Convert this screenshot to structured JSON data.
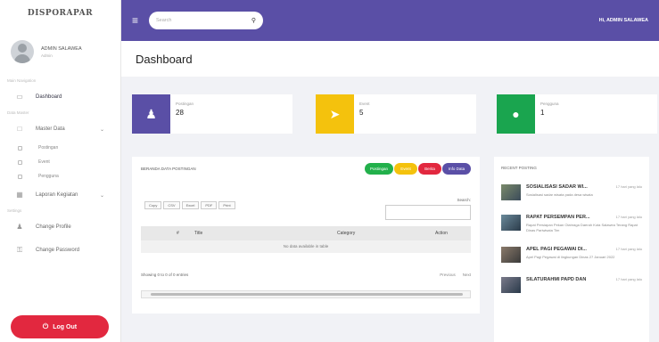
{
  "sidebar": {
    "brand": "DISPORAPAR",
    "user": {
      "name": "ADMIN SALAWEA",
      "role": "Admin"
    },
    "section_main": "Main Navigation",
    "dashboard_label": "Dashboard",
    "section_data": "Data Master",
    "master_data_label": "Master Data",
    "sub_items": [
      "Postingan",
      "Event",
      "Pengguna"
    ],
    "laporan_label": "Laporan Kegiatan",
    "section_settings": "Settings",
    "change_profile": "Change Profile",
    "change_password": "Change Password",
    "logout_label": "Log Out"
  },
  "topbar": {
    "search_placeholder": "Search",
    "greeting": "Hi, ADMIN SALAWEA"
  },
  "page": {
    "title": "Dashboard"
  },
  "stats": [
    {
      "label": "Postingan",
      "value": "28",
      "color": "#5a4fa6"
    },
    {
      "label": "Event",
      "value": "5",
      "color": "#f4c20d"
    },
    {
      "label": "Pengguna",
      "value": "1",
      "color": "#1aa54f"
    }
  ],
  "table_panel": {
    "title": "BERANDA DATA POSTINGAN",
    "pills": [
      {
        "label": "Postingan",
        "color": "#22b04b"
      },
      {
        "label": "Event",
        "color": "#f4c20d"
      },
      {
        "label": "Berita",
        "color": "#e2283f"
      },
      {
        "label": "Info Data",
        "color": "#5a4fa6"
      }
    ],
    "export_buttons": [
      "Copy",
      "CSV",
      "Excel",
      "PDF",
      "Print"
    ],
    "search_label": "Search:",
    "columns": [
      "#",
      "Title",
      "Category",
      "Action"
    ],
    "empty_message": "No data available in table",
    "showing": "Showing 0 to 0 of 0 entries",
    "prev_label": "Previous",
    "next_label": "Next"
  },
  "news_panel": {
    "title": "RECENT POSTING",
    "items": [
      {
        "headline": "SOSIALISASI SADAR WI...",
        "time": "17 hari yang lalu",
        "desc": "Sosialisasi sadar wisata pada desa wisata"
      },
      {
        "headline": "RAPAT PERSEMPAN PER...",
        "time": "17 hari yang lalu",
        "desc": "Rapat Persiapan Pekan Olahraga Daerah Kota Salawea Terang Rapat Dinas Pariwisata Tim"
      },
      {
        "headline": "APEL PAGI PEGAWAI DI...",
        "time": "17 hari yang lalu",
        "desc": "Apel Pagi Pegawai di lingkungan Dinas 27 Januari 2022"
      },
      {
        "headline": "SILATURAHMI PAPD DAN",
        "time": "17 hari yang lalu",
        "desc": ""
      }
    ]
  }
}
